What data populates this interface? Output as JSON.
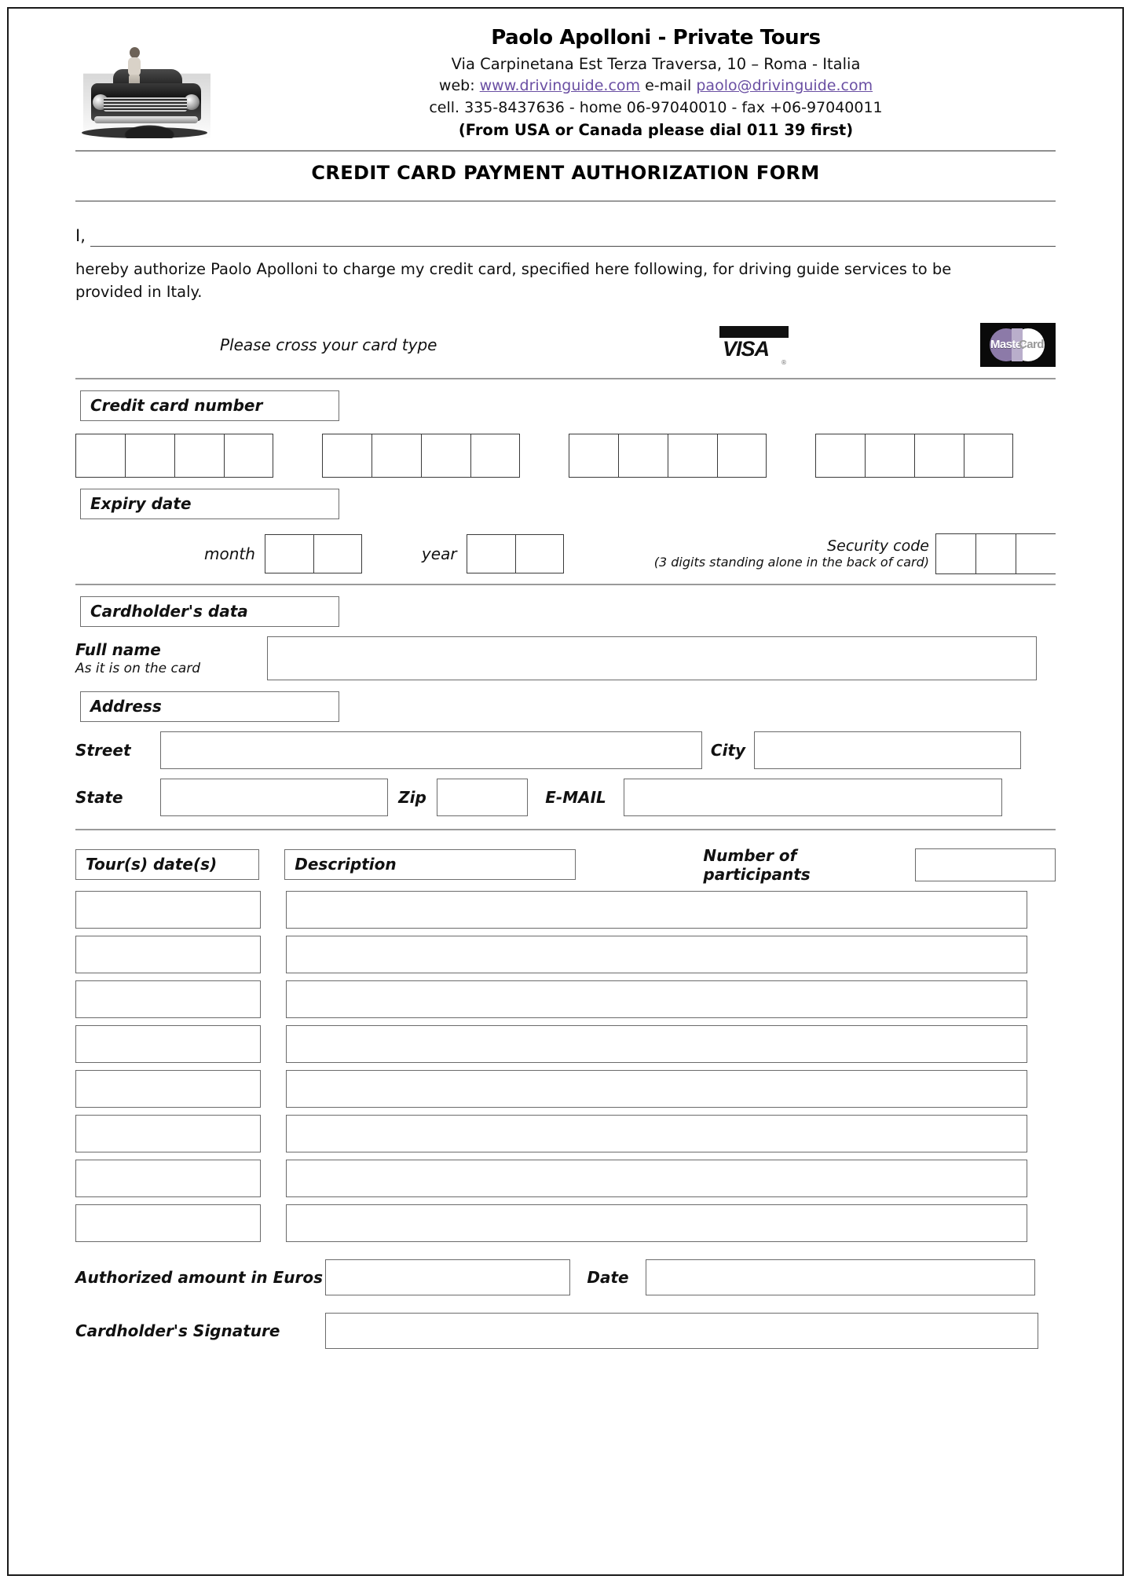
{
  "header": {
    "company": "Paolo Apolloni - Private Tours",
    "address": "Via Carpinetana Est Terza Traversa, 10 – Roma - Italia",
    "web_prefix": "web: ",
    "web_url": "www.drivinguide.com",
    "email_prefix": " e-mail ",
    "email": "paolo@drivinguide.com",
    "phones": "cell. 335-8437636 - home 06-97040010  - fax +06-97040011",
    "dial_note": "(From USA or Canada please dial 011  39 first)",
    "logo_alt": "vintage-car-photo"
  },
  "title": "CREDIT CARD PAYMENT AUTHORIZATION FORM",
  "authorization": {
    "i_label": "I,",
    "paragraph": "hereby authorize Paolo Apolloni to charge my credit card, specified here following, for driving guide services to be provided in Italy."
  },
  "card_type": {
    "instruction": "Please cross your card type",
    "visa_label": "VISA",
    "visa_mark": "®",
    "mastercard_label_1": "Master",
    "mastercard_label_2": "Card"
  },
  "credit_card": {
    "section_label": "Credit card number",
    "groups": 4,
    "boxes_per_group": 4
  },
  "expiry": {
    "section_label": "Expiry date",
    "month_label": "month",
    "month_boxes": 2,
    "year_label": "year",
    "year_boxes": 2,
    "security_label": "Security code",
    "security_note": "(3 digits standing alone in the back of card)",
    "security_boxes": 3
  },
  "cardholder": {
    "section_label": "Cardholder's data",
    "full_name_label": "Full name",
    "full_name_sub": "As it is on the card",
    "full_name_value": ""
  },
  "address": {
    "section_label": "Address",
    "street_label": "Street",
    "street_value": "",
    "city_label": "City",
    "city_value": "",
    "state_label": "State",
    "state_value": "",
    "zip_label": "Zip",
    "zip_value": "",
    "email_label": "E-MAIL",
    "email_value": ""
  },
  "tours": {
    "col_dates": "Tour(s) date(s)",
    "col_description": "Description",
    "col_participants": "Number of participants",
    "participants_value": "",
    "rows": [
      {
        "date": "",
        "description": ""
      },
      {
        "date": "",
        "description": ""
      },
      {
        "date": "",
        "description": ""
      },
      {
        "date": "",
        "description": ""
      },
      {
        "date": "",
        "description": ""
      },
      {
        "date": "",
        "description": ""
      },
      {
        "date": "",
        "description": ""
      },
      {
        "date": "",
        "description": ""
      }
    ]
  },
  "footer": {
    "amount_label": "Authorized amount in Euros",
    "amount_value": "",
    "date_label": "Date",
    "date_value": "",
    "signature_label": "Cardholder's Signature",
    "signature_value": ""
  }
}
